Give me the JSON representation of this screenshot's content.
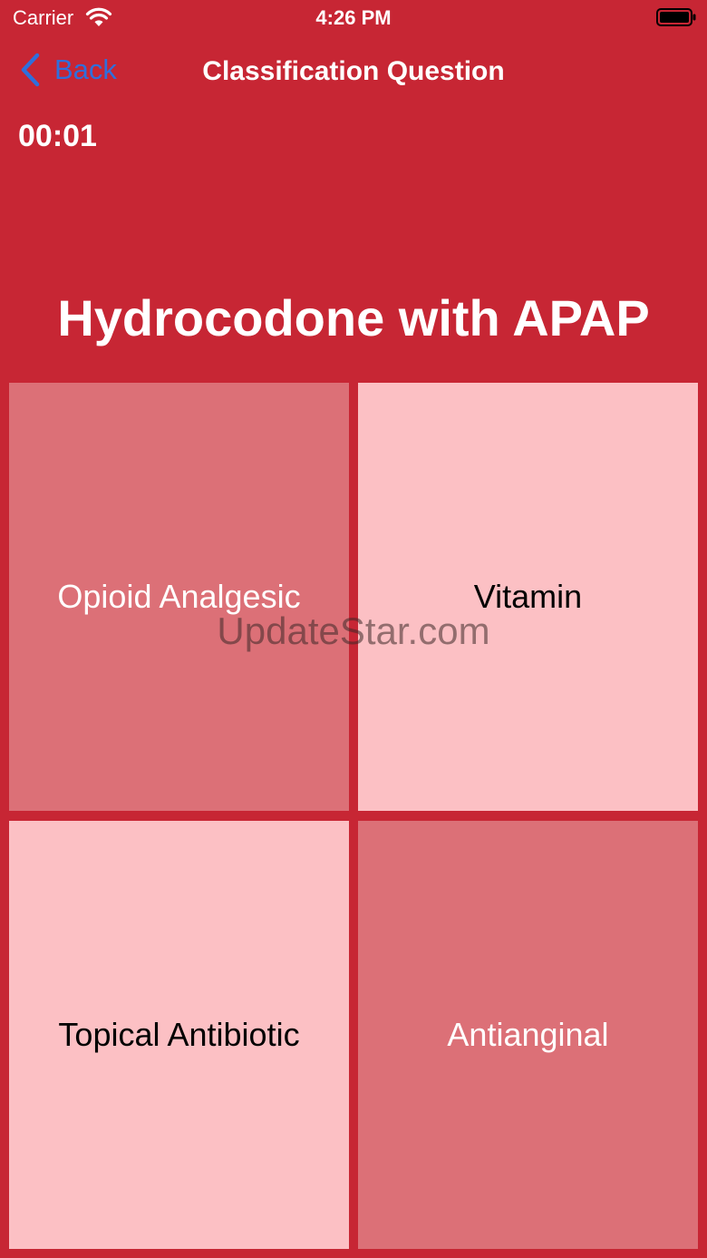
{
  "status_bar": {
    "carrier": "Carrier",
    "time": "4:26 PM"
  },
  "nav": {
    "back_label": "Back",
    "title": "Classification Question"
  },
  "timer": "00:01",
  "question": "Hydrocodone with APAP",
  "answers": [
    {
      "label": "Opioid Analgesic"
    },
    {
      "label": "Vitamin"
    },
    {
      "label": "Topical Antibiotic"
    },
    {
      "label": "Antianginal"
    }
  ],
  "watermark": "UpdateStar.com",
  "colors": {
    "background": "#c72634",
    "tile_dark": "#dc7077",
    "tile_light": "#fcc0c4",
    "back_link": "#2f6fdc"
  },
  "icons": [
    "wifi-icon",
    "battery-icon",
    "chevron-left-icon"
  ]
}
